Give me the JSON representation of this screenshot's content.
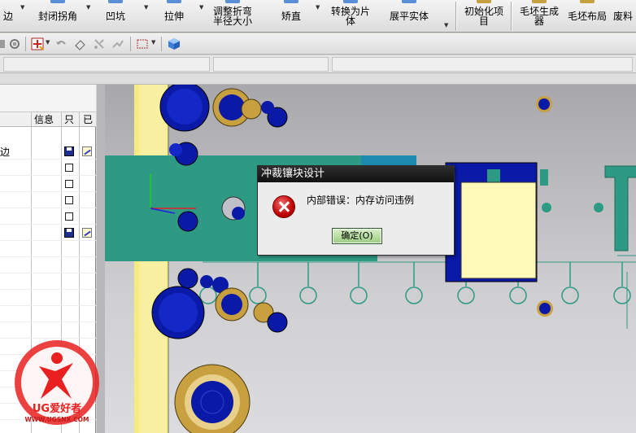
{
  "ribbon": {
    "items": [
      {
        "label": "边"
      },
      {
        "label": "封闭拐角"
      },
      {
        "label": "凹坑"
      },
      {
        "label": "拉伸"
      },
      {
        "label": "调整折弯",
        "label2": "半径大小"
      },
      {
        "label": "矫直"
      },
      {
        "label": "转换为片",
        "label2": "体"
      },
      {
        "label": "展平实体"
      },
      {
        "label": "初始化项",
        "label2": "目"
      },
      {
        "label": "毛坯生成",
        "label2": "器"
      },
      {
        "label": "毛坯布局"
      },
      {
        "label": "废料"
      }
    ]
  },
  "navigator": {
    "columns": [
      "信息",
      "只",
      "已"
    ],
    "rows": [
      {
        "label": "边",
        "locked": "save",
        "edit": true
      },
      {
        "label": "",
        "locked": "box"
      },
      {
        "label": "",
        "locked": "box"
      },
      {
        "label": "",
        "locked": "box"
      },
      {
        "label": "",
        "locked": "box"
      },
      {
        "label": "",
        "locked": "save",
        "edit": true
      }
    ]
  },
  "dialog": {
    "title": "冲裁镶块设计",
    "message": "内部错误：内存访问违例",
    "ok_label": "确定(O)"
  },
  "watermark": {
    "brand": "UG爱好者",
    "url": "WWW.UGSNX.COM"
  },
  "colors": {
    "part_teal": "#2e9a84",
    "hole_blue": "#0a1aa6",
    "plate_yellow": "#f5ec80",
    "accent_red": "#e82020"
  }
}
